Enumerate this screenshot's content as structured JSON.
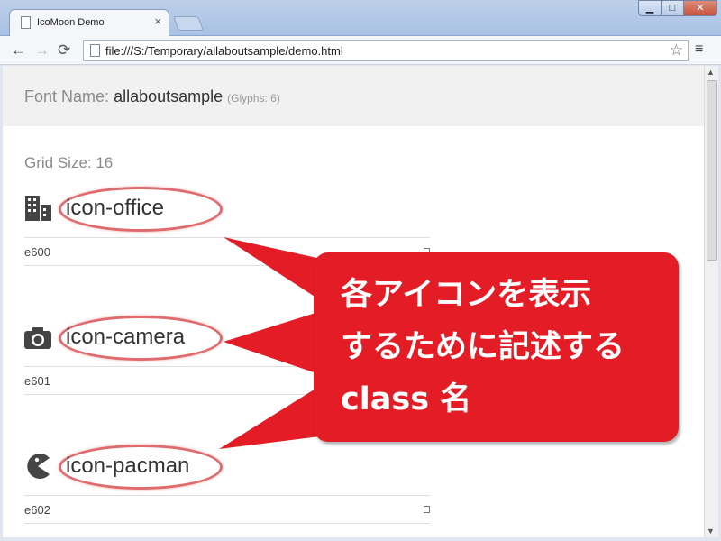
{
  "browser": {
    "tab_title": "IcoMoon Demo",
    "tab_close": "×",
    "url": "file:///S:/Temporary/allaboutsample/demo.html",
    "window_buttons": {
      "minimize": "▁",
      "maximize": "□",
      "close": "✕"
    },
    "nav": {
      "back": "←",
      "forward": "→",
      "reload": "⟳",
      "star": "☆",
      "menu": "≡"
    }
  },
  "page": {
    "font_name_label": "Font Name:",
    "font_name_value": "allaboutsample",
    "glyphs": "(Glyphs: 6)",
    "grid_size": "Grid Size: 16",
    "glyphs_list": [
      {
        "name": "icon-office",
        "code": "e600",
        "icon": "office-icon"
      },
      {
        "name": "icon-camera",
        "code": "e601",
        "icon": "camera-icon"
      },
      {
        "name": "icon-pacman",
        "code": "e602",
        "icon": "pacman-icon"
      }
    ]
  },
  "callout": {
    "text": "各アイコンを表示\nするために記述する\nclass 名",
    "color": "#e31c25"
  },
  "colors": {
    "highlight": "#df6b6d"
  }
}
